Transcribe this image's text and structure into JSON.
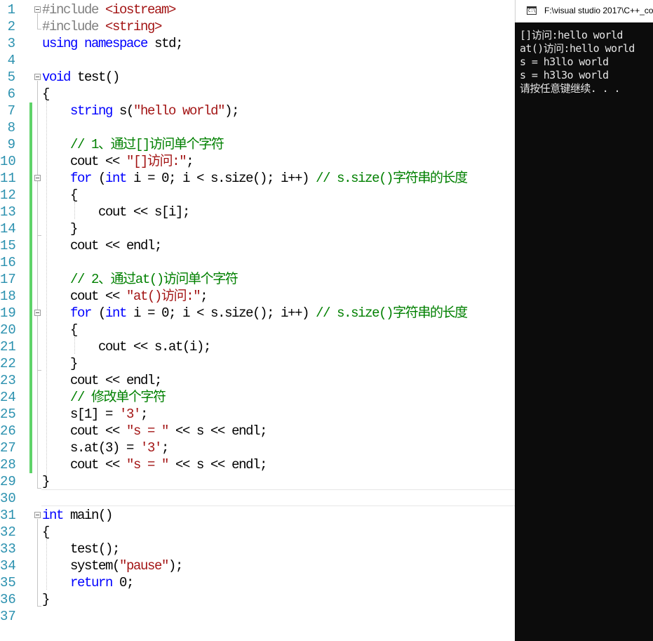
{
  "editor": {
    "line_numbers": [
      "1",
      "2",
      "3",
      "4",
      "5",
      "6",
      "7",
      "8",
      "9",
      "10",
      "11",
      "12",
      "13",
      "14",
      "15",
      "16",
      "17",
      "18",
      "19",
      "20",
      "21",
      "22",
      "23",
      "24",
      "25",
      "26",
      "27",
      "28",
      "29",
      "30",
      "31",
      "32",
      "33",
      "34",
      "35",
      "36",
      "37"
    ],
    "lines": [
      [
        {
          "t": "#include ",
          "c": "pp"
        },
        {
          "t": "<iostream>",
          "c": "inc"
        }
      ],
      [
        {
          "t": "#include ",
          "c": "pp"
        },
        {
          "t": "<string>",
          "c": "inc"
        }
      ],
      [
        {
          "t": "using",
          "c": "kw"
        },
        {
          "t": " "
        },
        {
          "t": "namespace",
          "c": "kw"
        },
        {
          "t": " std;"
        }
      ],
      [],
      [
        {
          "t": "void",
          "c": "kw"
        },
        {
          "t": " test()"
        }
      ],
      [
        {
          "t": "{"
        }
      ],
      [
        {
          "t": "    "
        },
        {
          "t": "string",
          "c": "kw"
        },
        {
          "t": " s("
        },
        {
          "t": "\"hello world\"",
          "c": "str"
        },
        {
          "t": ");"
        }
      ],
      [],
      [
        {
          "t": "    "
        },
        {
          "t": "// 1、通过[]访问单个字符",
          "c": "com"
        }
      ],
      [
        {
          "t": "    cout << "
        },
        {
          "t": "\"[]访问:\"",
          "c": "str"
        },
        {
          "t": ";"
        }
      ],
      [
        {
          "t": "    "
        },
        {
          "t": "for",
          "c": "kw"
        },
        {
          "t": " ("
        },
        {
          "t": "int",
          "c": "kw"
        },
        {
          "t": " i = 0; i < s.size(); i++) "
        },
        {
          "t": "// s.size()字符串的长度",
          "c": "com"
        }
      ],
      [
        {
          "t": "    {"
        }
      ],
      [
        {
          "t": "        cout << s[i];"
        }
      ],
      [
        {
          "t": "    }"
        }
      ],
      [
        {
          "t": "    cout << endl;"
        }
      ],
      [],
      [
        {
          "t": "    "
        },
        {
          "t": "// 2、通过at()访问单个字符",
          "c": "com"
        }
      ],
      [
        {
          "t": "    cout << "
        },
        {
          "t": "\"at()访问:\"",
          "c": "str"
        },
        {
          "t": ";"
        }
      ],
      [
        {
          "t": "    "
        },
        {
          "t": "for",
          "c": "kw"
        },
        {
          "t": " ("
        },
        {
          "t": "int",
          "c": "kw"
        },
        {
          "t": " i = 0; i < s.size(); i++) "
        },
        {
          "t": "// s.size()字符串的长度",
          "c": "com"
        }
      ],
      [
        {
          "t": "    {"
        }
      ],
      [
        {
          "t": "        cout << s.at(i);"
        }
      ],
      [
        {
          "t": "    }"
        }
      ],
      [
        {
          "t": "    cout << endl;"
        }
      ],
      [
        {
          "t": "    "
        },
        {
          "t": "// 修改单个字符",
          "c": "com"
        }
      ],
      [
        {
          "t": "    s[1] = "
        },
        {
          "t": "'3'",
          "c": "str"
        },
        {
          "t": ";"
        }
      ],
      [
        {
          "t": "    cout << "
        },
        {
          "t": "\"s = \"",
          "c": "str"
        },
        {
          "t": " << s << endl;"
        }
      ],
      [
        {
          "t": "    s.at(3) = "
        },
        {
          "t": "'3'",
          "c": "str"
        },
        {
          "t": ";"
        }
      ],
      [
        {
          "t": "    cout << "
        },
        {
          "t": "\"s = \"",
          "c": "str"
        },
        {
          "t": " << s << endl;"
        }
      ],
      [
        {
          "t": "}"
        }
      ],
      [],
      [
        {
          "t": "int",
          "c": "kw"
        },
        {
          "t": " main()"
        }
      ],
      [
        {
          "t": "{"
        }
      ],
      [
        {
          "t": "    test();"
        }
      ],
      [
        {
          "t": "    system("
        },
        {
          "t": "\"pause\"",
          "c": "str"
        },
        {
          "t": ");"
        }
      ],
      [
        {
          "t": "    "
        },
        {
          "t": "return",
          "c": "kw"
        },
        {
          "t": " 0;"
        }
      ],
      [
        {
          "t": "}"
        }
      ],
      []
    ]
  },
  "console": {
    "title": "F:\\visual studio 2017\\C++_co",
    "icon": "console-app-icon",
    "output": [
      "[]访问:hello world",
      "at()访问:hello world",
      "s = h3llo world",
      "s = h3l3o world",
      "请按任意键继续. . ."
    ]
  },
  "colors": {
    "keyword": "#0000ff",
    "string": "#a31515",
    "comment": "#008000",
    "preprocessor": "#808080",
    "line_number": "#2b91af",
    "change_bar": "#5fd36a",
    "console_bg": "#0c0c0c",
    "console_text": "#e6e6e6"
  }
}
